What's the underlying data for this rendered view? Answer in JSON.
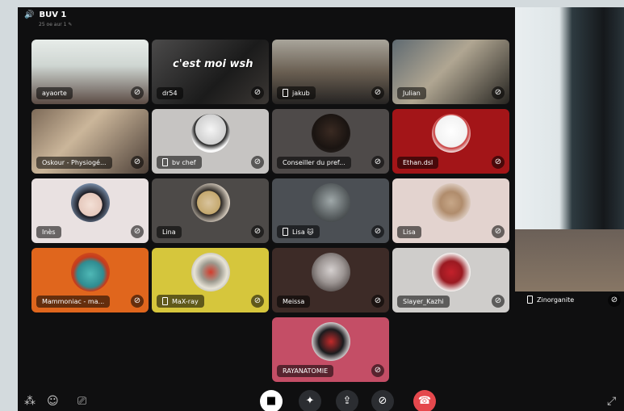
{
  "server": {
    "title": "BUV 1",
    "subtitle": "25 oe aur 1"
  },
  "overlay_caption": "c'est moi wsh",
  "tiles": [
    {
      "name": "ayaorte",
      "phone": false
    },
    {
      "name": "dr54",
      "phone": false
    },
    {
      "name": "jakub",
      "phone": true
    },
    {
      "name": "Julian",
      "phone": false
    },
    {
      "name": "Oskour - Physiogé...",
      "phone": false
    },
    {
      "name": "bv chef",
      "phone": true
    },
    {
      "name": "Conseiller du pref...",
      "phone": false
    },
    {
      "name": "Ethan.dsl",
      "phone": false
    },
    {
      "name": "Inès",
      "phone": false
    },
    {
      "name": "Lina",
      "phone": false
    },
    {
      "name": "Lisa 🐱",
      "phone": true
    },
    {
      "name": "Lisa",
      "phone": false
    },
    {
      "name": "Mammoniac - ma...",
      "phone": false
    },
    {
      "name": "MaX-ray",
      "phone": true
    },
    {
      "name": "Meissa",
      "phone": false
    },
    {
      "name": "Slayer_Kazhi",
      "phone": false
    },
    {
      "name": "RAYANATOMIE",
      "phone": false
    }
  ],
  "side_tile": {
    "name": "Zinorganite",
    "phone": true
  },
  "controls": {
    "camera": "camera",
    "activities": "activities",
    "screenshare": "screen-share",
    "mute": "mute",
    "leave": "leave-call"
  },
  "colors": {
    "leave": "#e5484d",
    "accent": "#ffffff"
  }
}
